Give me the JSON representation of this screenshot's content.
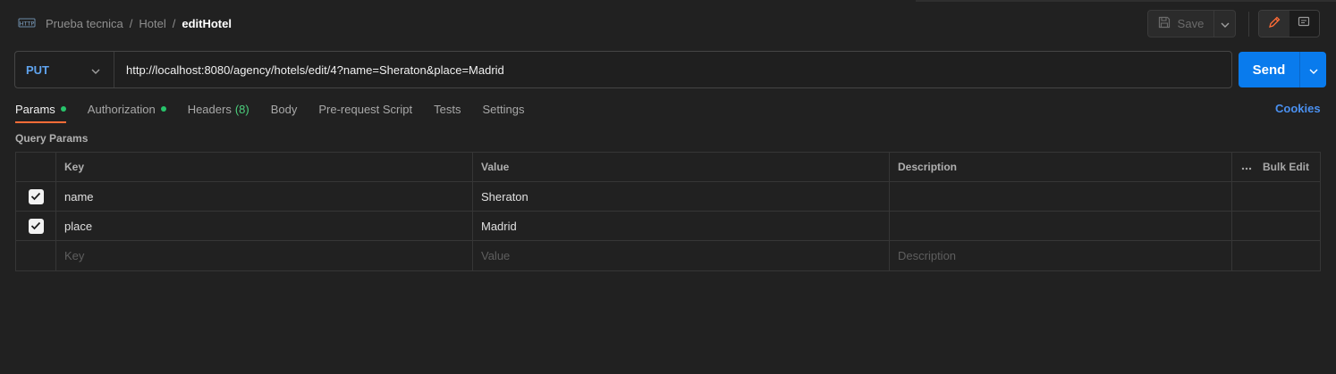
{
  "breadcrumb": {
    "items": [
      "Prueba tecnica",
      "Hotel"
    ],
    "separator": "/",
    "current": "editHotel"
  },
  "toolbar": {
    "save_label": "Save"
  },
  "request": {
    "method": "PUT",
    "url": "http://localhost:8080/agency/hotels/edit/4?name=Sheraton&place=Madrid",
    "send_label": "Send"
  },
  "tabs": [
    {
      "label": "Params",
      "dot": true,
      "active": true
    },
    {
      "label": "Authorization",
      "dot": true
    },
    {
      "label": "Headers",
      "count": "(8)"
    },
    {
      "label": "Body"
    },
    {
      "label": "Pre-request Script"
    },
    {
      "label": "Tests"
    },
    {
      "label": "Settings"
    }
  ],
  "cookies_label": "Cookies",
  "params": {
    "title": "Query Params",
    "columns": {
      "key": "Key",
      "value": "Value",
      "description": "Description"
    },
    "bulk_edit_label": "Bulk Edit",
    "rows": [
      {
        "key": "name",
        "value": "Sheraton",
        "description": "",
        "checked": true
      },
      {
        "key": "place",
        "value": "Madrid",
        "description": "",
        "checked": true
      }
    ],
    "placeholders": {
      "key": "Key",
      "value": "Value",
      "description": "Description"
    }
  },
  "colors": {
    "accent_tab": "#ff6c37",
    "send": "#097bed",
    "method": "#5fa3ee",
    "dot": "#27c46b",
    "link": "#4a90f0"
  }
}
